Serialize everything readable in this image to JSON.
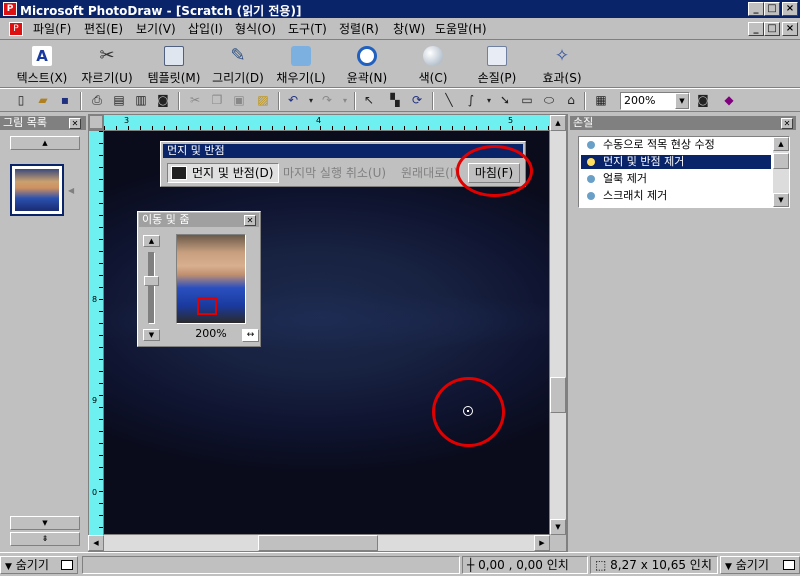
{
  "window": {
    "title": "Microsoft PhotoDraw - [Scratch (읽기 전용)]"
  },
  "menu": [
    "파일(F)",
    "편집(E)",
    "보기(V)",
    "삽입(I)",
    "형식(O)",
    "도구(T)",
    "정렬(R)",
    "창(W)",
    "도움말(H)"
  ],
  "big_toolbar": [
    {
      "label": "텍스트(X)",
      "icon": "text-icon"
    },
    {
      "label": "자르기(U)",
      "icon": "scissors-icon"
    },
    {
      "label": "템플릿(M)",
      "icon": "template-icon"
    },
    {
      "label": "그리기(D)",
      "icon": "pencil-icon"
    },
    {
      "label": "채우기(L)",
      "icon": "paint-bucket-icon"
    },
    {
      "label": "윤곽(N)",
      "icon": "outline-icon"
    },
    {
      "label": "색(C)",
      "icon": "color-icon"
    },
    {
      "label": "손질(P)",
      "icon": "touchup-icon"
    },
    {
      "label": "효과(S)",
      "icon": "effects-icon"
    }
  ],
  "std_toolbar": {
    "zoom": "200%"
  },
  "gallery": {
    "title": "그림 목록"
  },
  "edit_bar": {
    "title": "먼지 및 반점",
    "tool_label": "먼지 및 반점(D)",
    "undo_label": "마지막 실행 취소(U)",
    "restore_label": "원래대로(I)",
    "finish_label": "마침(F)"
  },
  "pan_zoom": {
    "title": "이동 및 줌",
    "zoom": "200%"
  },
  "touchup_pane": {
    "title": "손질",
    "items": [
      "수동으로 적목 현상 수정",
      "먼지 및 반점 제거",
      "얼룩 제거",
      "스크래치 제거"
    ],
    "selected_index": 1
  },
  "rulers": {
    "h_ticks": [
      "3",
      "4",
      "5"
    ],
    "v_ticks": [
      "8",
      "9",
      "0"
    ]
  },
  "status": {
    "hide_left": "숨기기",
    "position": "0,00 , 0,00 인치",
    "size": "8,27 x 10,65 인치",
    "hide_right": "숨기기"
  },
  "colors": {
    "titlebar": "#0a246a",
    "ruler": "#6ff0f0",
    "highlight": "#0a246a",
    "annotation": "#e00000"
  }
}
